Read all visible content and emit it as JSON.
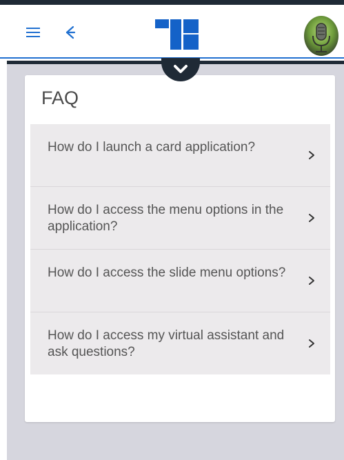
{
  "header": {
    "menu_icon": "hamburger-menu-icon",
    "back_icon": "back-arrow-icon",
    "logo_icon": "brand-logo-icon",
    "avatar_icon": "microphone-avatar-icon",
    "collapse_icon": "chevron-down-icon"
  },
  "faq": {
    "title": "FAQ",
    "items": [
      {
        "question": "How do I launch a card application?"
      },
      {
        "question": "How do I access the menu options in the application?"
      },
      {
        "question": "How do I access the slide menu options?"
      },
      {
        "question": "How do I access my virtual assistant and ask questions?"
      }
    ]
  },
  "colors": {
    "accent": "#1f6fd0",
    "dark": "#1f2a36",
    "content_bg": "#d6d6de",
    "item_bg": "#eceaec"
  }
}
